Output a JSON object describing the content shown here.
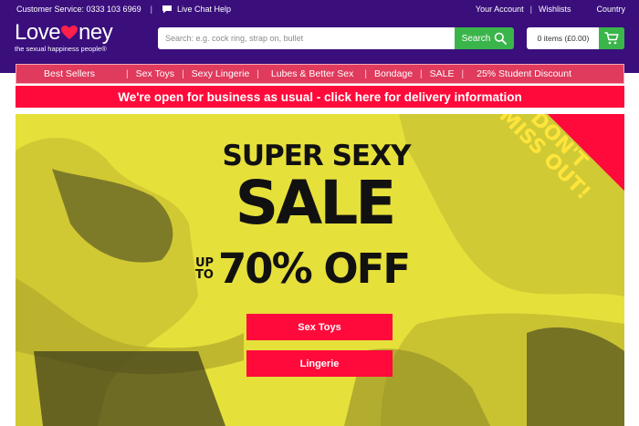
{
  "utility_bar": {
    "customer_service": "Customer Service: 0333 103 6969",
    "live_chat": "Live Chat Help",
    "your_account": "Your Account",
    "wishlists": "Wishlists",
    "country": "Country"
  },
  "logo": {
    "word_left": "Love",
    "word_right": "ney",
    "tagline": "the sexual happiness people®"
  },
  "search": {
    "placeholder": "Search: e.g. cock ring, strap on, bullet",
    "button_label": "Search"
  },
  "basket": {
    "summary": "0 items (£0.00)"
  },
  "nav": {
    "items": [
      "Best Sellers",
      "Sex Toys",
      "Sexy Lingerie",
      "Lubes & Better Sex",
      "Bondage",
      "SALE",
      "25% Student Discount"
    ]
  },
  "notice": {
    "text": "We're open for business as usual - click here for delivery information"
  },
  "hero": {
    "line1": "SUPER SEXY",
    "line2": "SALE",
    "upto_line1": "UP",
    "upto_line2": "TO",
    "discount": "70% OFF",
    "cta_primary": "Sex Toys",
    "cta_secondary": "Lingerie",
    "ribbon_line1": "DON'T",
    "ribbon_line2": "MISS OUT!"
  },
  "colors": {
    "header_bg": "#3a0f7c",
    "accent_green": "#3ab54a",
    "nav_bg": "#e03a5c",
    "notice_red": "#ff0a3a",
    "hero_yellow": "#e6e03b"
  }
}
